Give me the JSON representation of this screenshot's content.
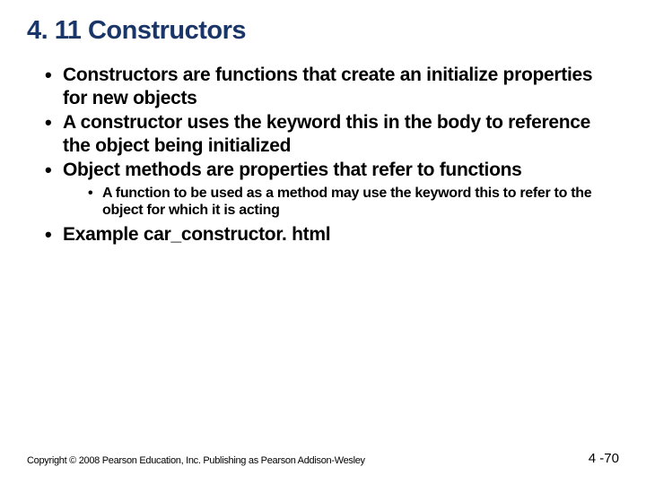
{
  "title": "4. 11 Constructors",
  "bullets": {
    "b1": "Constructors are functions that create an initialize properties for new objects",
    "b2": "A constructor uses the keyword this in the body to reference the object being initialized",
    "b3": "Object methods are properties that refer to functions",
    "b3_sub1": "A function to be used as a method may use the keyword this to refer to the object for which it is acting",
    "b4": "Example car_constructor. html"
  },
  "footer": {
    "copyright": "Copyright © 2008 Pearson Education, Inc. Publishing as Pearson Addison-Wesley",
    "page": "4 -70"
  }
}
